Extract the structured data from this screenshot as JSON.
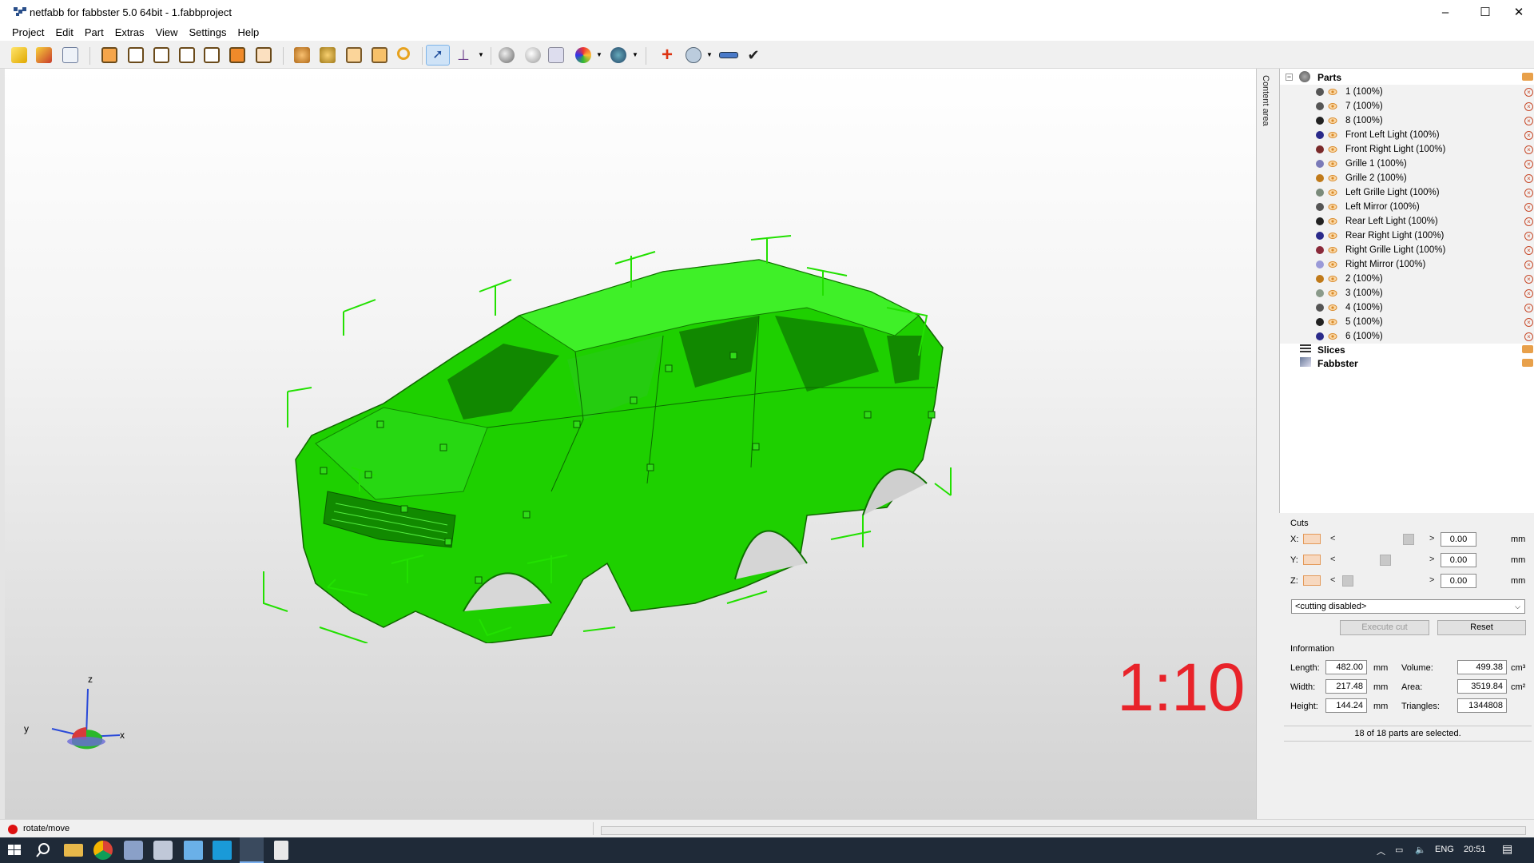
{
  "window": {
    "title": "netfabb for fabbster 5.0 64bit - 1.fabbproject",
    "controls": [
      "–",
      "☐",
      "✕"
    ]
  },
  "menu": [
    "Project",
    "Edit",
    "Part",
    "Extras",
    "View",
    "Settings",
    "Help"
  ],
  "toolbar": {
    "icons": [
      "open-project-icon",
      "add-part-icon",
      "project-info-icon",
      "view-front-icon",
      "view-back-icon",
      "view-left-icon",
      "view-right-icon",
      "view-top-icon",
      "view-bottom-icon",
      "view-iso-icon",
      "zoom-selection-icon",
      "zoom-all-icon",
      "zoom-platform-icon",
      "zoom-fit-icon",
      "zoom-icon",
      "select-cursor-icon",
      "coordinate-system-icon",
      "shading-icon",
      "lighting-icon",
      "measure-points-icon",
      "color-wheel-icon",
      "view-options-icon",
      "repair-icon",
      "analysis-icon",
      "ruler-icon",
      "checkmark-icon"
    ]
  },
  "viewport": {
    "scale_label": "1:10",
    "axes": {
      "x": "x",
      "y": "y",
      "z": "z"
    },
    "side_tab": "Content area",
    "model_color": "#22dd00"
  },
  "tree": {
    "root": "Parts",
    "parts": [
      {
        "label": "1 (100%)",
        "color": "#555555"
      },
      {
        "label": "7 (100%)",
        "color": "#555555"
      },
      {
        "label": "8 (100%)",
        "color": "#222222"
      },
      {
        "label": "Front Left Light (100%)",
        "color": "#2a2a8a"
      },
      {
        "label": "Front Right Light (100%)",
        "color": "#7a2a2a"
      },
      {
        "label": "Grille 1 (100%)",
        "color": "#7a7ab8"
      },
      {
        "label": "Grille 2 (100%)",
        "color": "#c07a1a"
      },
      {
        "label": "Left Grille Light (100%)",
        "color": "#7a8a7a"
      },
      {
        "label": "Left Mirror (100%)",
        "color": "#555555"
      },
      {
        "label": "Rear Left Light (100%)",
        "color": "#222222"
      },
      {
        "label": "Rear Right Light (100%)",
        "color": "#2a2a8a"
      },
      {
        "label": "Right Grille Light (100%)",
        "color": "#8a2a3a"
      },
      {
        "label": "Right Mirror (100%)",
        "color": "#9a9ad8"
      },
      {
        "label": "2 (100%)",
        "color": "#c07a1a"
      },
      {
        "label": "3 (100%)",
        "color": "#8a9a8a"
      },
      {
        "label": "4 (100%)",
        "color": "#555555"
      },
      {
        "label": "5 (100%)",
        "color": "#222222"
      },
      {
        "label": "6 (100%)",
        "color": "#2a2a8a"
      }
    ],
    "slices": "Slices",
    "fabbster": "Fabbster"
  },
  "cuts": {
    "title": "Cuts",
    "rows": [
      {
        "axis": "X:",
        "value": "0.00",
        "unit": "mm",
        "position": 0.88
      },
      {
        "axis": "Y:",
        "value": "0.00",
        "unit": "mm",
        "position": 0.55
      },
      {
        "axis": "Z:",
        "value": "0.00",
        "unit": "mm",
        "position": 0.03
      }
    ],
    "mode": "<cutting disabled>",
    "execute_label": "Execute cut",
    "reset_label": "Reset"
  },
  "information": {
    "title": "Information",
    "length_label": "Length:",
    "length": "482.00",
    "length_unit": "mm",
    "width_label": "Width:",
    "width": "217.48",
    "width_unit": "mm",
    "height_label": "Height:",
    "height": "144.24",
    "height_unit": "mm",
    "volume_label": "Volume:",
    "volume": "499.38",
    "volume_unit": "cm³",
    "area_label": "Area:",
    "area": "3519.84",
    "area_unit": "cm²",
    "triangles_label": "Triangles:",
    "triangles": "1344808",
    "selection_status": "18 of 18 parts are selected."
  },
  "status": {
    "mode": "rotate/move"
  },
  "taskbar": {
    "icons": [
      "windows-start-icon",
      "search-icon",
      "file-explorer-icon",
      "chrome-icon",
      "app-icon-1",
      "app-icon-2",
      "notepad-icon",
      "app-icon-3",
      "netfabb-icon",
      "calculator-icon"
    ],
    "language": "ENG",
    "time": "20:51"
  }
}
